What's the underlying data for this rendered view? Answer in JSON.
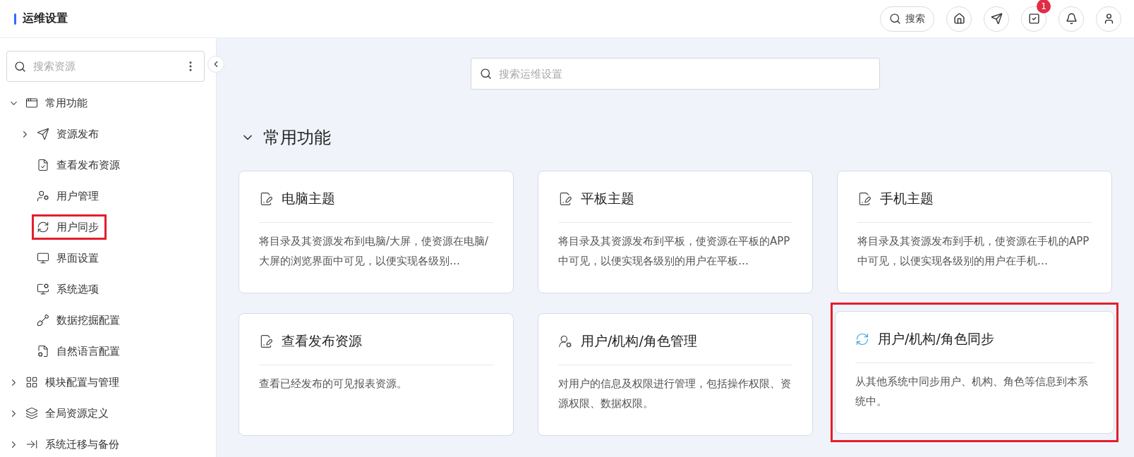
{
  "header": {
    "title": "运维设置",
    "search_label": "搜索",
    "task_badge": "1"
  },
  "sidebar": {
    "search": {
      "placeholder": "搜索资源"
    },
    "tree": [
      {
        "label": "常用功能",
        "expanded": true,
        "children": [
          {
            "label": "资源发布",
            "expanded": false,
            "highlighted": false
          },
          {
            "label": "查看发布资源",
            "highlighted": false
          },
          {
            "label": "用户管理",
            "highlighted": false
          },
          {
            "label": "用户同步",
            "highlighted": true
          },
          {
            "label": "界面设置",
            "highlighted": false
          },
          {
            "label": "系统选项",
            "highlighted": false
          },
          {
            "label": "数据挖掘配置",
            "highlighted": false
          },
          {
            "label": "自然语言配置",
            "highlighted": false
          }
        ]
      },
      {
        "label": "模块配置与管理",
        "expanded": false
      },
      {
        "label": "全局资源定义",
        "expanded": false
      },
      {
        "label": "系统迁移与备份",
        "expanded": false
      }
    ]
  },
  "main": {
    "search": {
      "placeholder": "搜索运维设置"
    },
    "section": {
      "title": "常用功能",
      "expanded": true
    },
    "cards": [
      {
        "title": "电脑主题",
        "description": "将目录及其资源发布到电脑/大屏，使资源在电脑/大屏的浏览界面中可见，以便实现各级别…",
        "highlighted": false
      },
      {
        "title": "平板主题",
        "description": "将目录及其资源发布到平板，使资源在平板的APP中可见，以便实现各级别的用户在平板…",
        "highlighted": false
      },
      {
        "title": "手机主题",
        "description": "将目录及其资源发布到手机，使资源在手机的APP中可见，以便实现各级别的用户在手机…",
        "highlighted": false
      },
      {
        "title": "查看发布资源",
        "description": "查看已经发布的可见报表资源。",
        "highlighted": false
      },
      {
        "title": "用户/机构/角色管理",
        "description": "对用户的信息及权限进行管理，包括操作权限、资源权限、数据权限。",
        "highlighted": false
      },
      {
        "title": "用户/机构/角色同步",
        "description": "从其他系统中同步用户、机构、角色等信息到本系统中。",
        "highlighted": true
      }
    ]
  }
}
